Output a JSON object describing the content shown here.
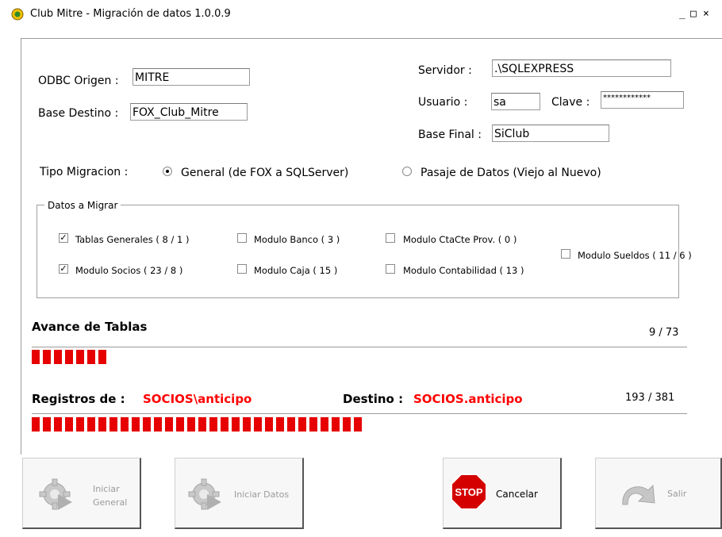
{
  "window": {
    "title": "Club Mitre - Migración de datos 1.0.0.9",
    "controls": [
      "_",
      "□",
      "×"
    ]
  },
  "connection": {
    "odbc_label": "ODBC Origen :",
    "odbc_value": "MITRE",
    "base_destino_label": "Base Destino :",
    "base_destino_value": "FOX_Club_Mitre",
    "servidor_label": "Servidor :",
    "servidor_value": ".\\SQLEXPRESS",
    "usuario_label": "Usuario :",
    "usuario_value": "sa",
    "clave_label": "Clave :",
    "clave_value": "************",
    "base_final_label": "Base Final :",
    "base_final_value": "SiClub"
  },
  "migration_type": {
    "label": "Tipo Migracion :",
    "options": [
      {
        "label": "General (de FOX a SQLServer)",
        "selected": true
      },
      {
        "label": "Pasaje de Datos (Viejo al Nuevo)",
        "selected": false
      }
    ]
  },
  "datos_migrar": {
    "title": "Datos a Migrar",
    "items": [
      {
        "label": "Tablas Generales  ( 8 / 1 )",
        "checked": true
      },
      {
        "label": "Modulo Banco ( 3 )",
        "checked": false
      },
      {
        "label": "Modulo CtaCte Prov. ( 0 )",
        "checked": false
      },
      {
        "label": "Modulo Socios ( 23 / 8 )",
        "checked": true
      },
      {
        "label": "Modulo Caja ( 15 )",
        "checked": false
      },
      {
        "label": "Modulo Contabilidad ( 13 )",
        "checked": false
      },
      {
        "label": "Modulo Sueldos ( 11 / 6 )",
        "checked": false
      }
    ]
  },
  "avance": {
    "title": "Avance de Tablas",
    "count": "9 / 73",
    "progress": 0.1233
  },
  "registros": {
    "label": "Registros de :",
    "value": "SOCIOS\\anticipo",
    "destino_label": "Destino :",
    "destino_value": "SOCIOS.anticipo",
    "count": "193 / 381",
    "progress": 0.5066
  },
  "buttons": {
    "iniciar_general": "Iniciar\nGeneral",
    "iniciar_datos": "Iniciar Datos",
    "stop_icon_text": "STOP",
    "cancelar": "Cancelar",
    "salir": "Salir"
  },
  "colors": {
    "progress": "#e60000",
    "highlight_text": "#ff0000"
  }
}
